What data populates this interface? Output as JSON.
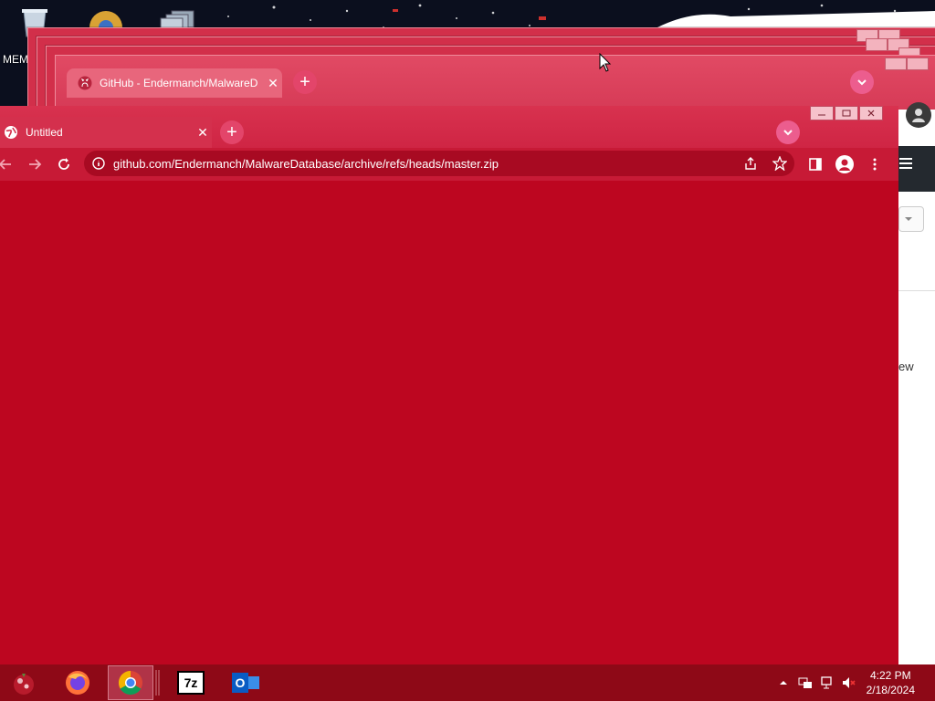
{
  "desktop": {
    "label": "MEM"
  },
  "back_window": {
    "tab_title": "GitHub - Endermanch/MalwareD",
    "new_tab_symbol": "+",
    "close_symbol": "✕"
  },
  "main_window": {
    "tab_title": "Untitled",
    "close_symbol": "✕",
    "new_tab_symbol": "+",
    "address": "github.com/Endermanch/MalwareDatabase/archive/refs/heads/master.zip"
  },
  "peek_page": {
    "text": "ew"
  },
  "taskbar": {
    "apps": [
      {
        "name": "Firefox"
      },
      {
        "name": "Google Chrome"
      },
      {
        "name": "7-Zip",
        "label": "7z"
      },
      {
        "name": "Outlook",
        "label": "O"
      }
    ],
    "clock": {
      "time": "4:22 PM",
      "date": "2/18/2024"
    }
  },
  "colors": {
    "content_bg": "#bd0620",
    "toolbar": "#c71a36",
    "taskbar": "#8e0917"
  }
}
